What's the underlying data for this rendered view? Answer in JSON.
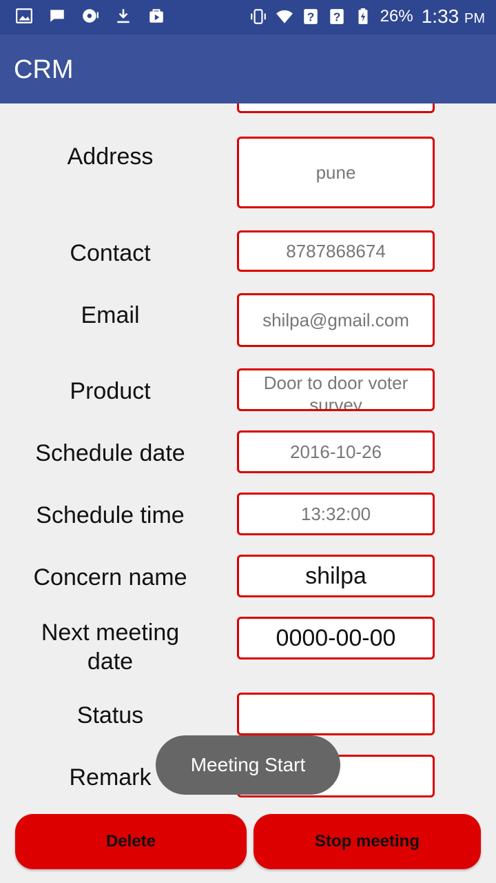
{
  "status_bar": {
    "left_icons": [
      "image-icon",
      "chat-icon",
      "disc-icon",
      "download-icon",
      "store-icon"
    ],
    "battery_percent": "26%",
    "time": "1:33",
    "ampm": "PM"
  },
  "app": {
    "title": "CRM"
  },
  "form": {
    "fields": [
      {
        "label": "Address",
        "value": "pune"
      },
      {
        "label": "Contact",
        "value": "8787868674"
      },
      {
        "label": "Email",
        "value": "shilpa@gmail.com"
      },
      {
        "label": "Product",
        "value": "Door to door voter survey"
      },
      {
        "label": "Schedule date",
        "value": "2016-10-26"
      },
      {
        "label": "Schedule time",
        "value": "13:32:00"
      },
      {
        "label": "Concern name",
        "value": "shilpa"
      },
      {
        "label_line1": "Next meeting",
        "label_line2": "date",
        "value": "0000-00-00"
      },
      {
        "label": "Status",
        "value": ""
      },
      {
        "label": "Remark",
        "value": ""
      }
    ]
  },
  "buttons": {
    "delete": "Delete",
    "stop_meeting": "Stop meeting"
  },
  "toast": {
    "message": "Meeting Start"
  },
  "colors": {
    "status_bar": "#2f4791",
    "app_bar": "#3b5199",
    "field_border": "#d90000",
    "button": "#dc0000"
  }
}
